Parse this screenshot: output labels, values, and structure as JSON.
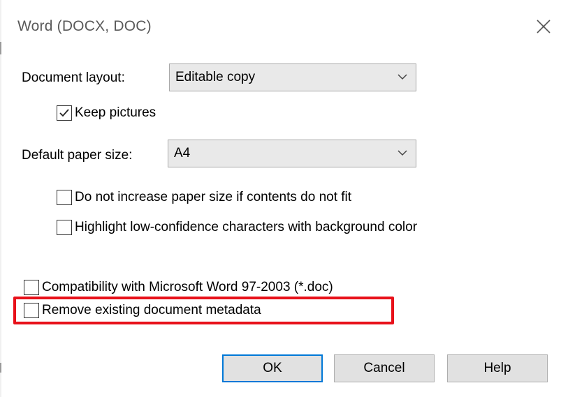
{
  "dialog": {
    "title": "Word (DOCX, DOC)"
  },
  "layout_section": {
    "label": "Document layout:",
    "value": "Editable copy",
    "keep_pictures": {
      "label": "Keep pictures",
      "checked": true
    }
  },
  "paper_section": {
    "label": "Default paper size:",
    "value": "A4",
    "no_increase": {
      "label": "Do not increase paper size if contents do not fit",
      "checked": false
    },
    "highlight_low_conf": {
      "label": "Highlight low-confidence characters with background color",
      "checked": false
    }
  },
  "options": {
    "compatibility": {
      "label": "Compatibility with Microsoft Word 97-2003 (*.doc)",
      "checked": false
    },
    "remove_metadata": {
      "label": "Remove existing document metadata",
      "checked": false
    }
  },
  "buttons": {
    "ok": "OK",
    "cancel": "Cancel",
    "help": "Help"
  },
  "colors": {
    "highlight": "#e8111a",
    "combo_bg": "#e9e9e9",
    "button_bg": "#e1e1e1",
    "default_button_border": "#0078d7"
  }
}
